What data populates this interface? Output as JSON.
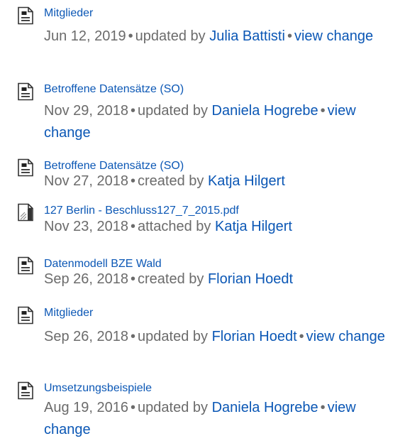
{
  "items": [
    {
      "icon": "page-icon",
      "title": "Mitglieder",
      "date": "Jun 12, 2019",
      "action": "updated by",
      "user": "Julia Battisti",
      "change_label": "view change"
    },
    {
      "icon": "page-icon",
      "title": "Betroffene Datensätze (SO)",
      "date": "Nov 29, 2018",
      "action": "updated by",
      "user": "Daniela Hogrebe",
      "change_label": "view change"
    },
    {
      "icon": "page-icon",
      "title": "Betroffene Datensätze (SO)",
      "date": "Nov 27, 2018",
      "action": "created by",
      "user": "Katja Hilgert"
    },
    {
      "icon": "pdf-file-icon",
      "title": "127 Berlin - Beschluss127_7_2015.pdf",
      "date": "Nov 23, 2018",
      "action": "attached by",
      "user": "Katja Hilgert"
    },
    {
      "icon": "page-icon",
      "title": "Datenmodell BZE Wald",
      "date": "Sep 26, 2018",
      "action": "created by",
      "user": "Florian Hoedt"
    },
    {
      "icon": "page-icon",
      "title": "Mitglieder",
      "date": "Sep 26, 2018",
      "action": "updated by",
      "user": "Florian Hoedt",
      "change_label": "view change"
    },
    {
      "icon": "page-icon",
      "title": "Umsetzungsbeispiele",
      "date": "Aug 19, 2016",
      "action": "updated by",
      "user": "Daniela Hogrebe",
      "change_label": "view change"
    }
  ],
  "separator": "•",
  "colors": {
    "link": "#0b57b5",
    "meta_text": "#6b6b6b"
  }
}
